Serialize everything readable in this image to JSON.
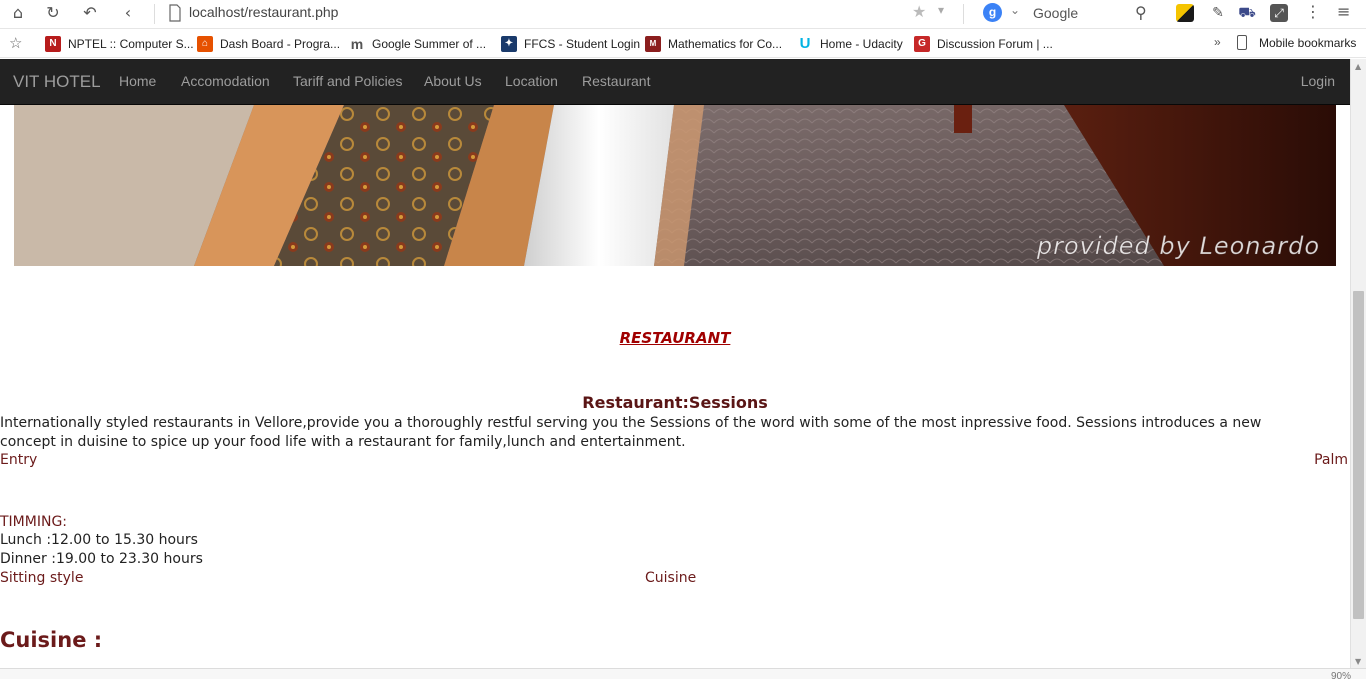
{
  "browser": {
    "url": "localhost/restaurant.php",
    "search_engine": "Google",
    "search_badge": "g",
    "zoom": "90%",
    "bookmarks": [
      {
        "label": "NPTEL :: Computer S...",
        "icon": "nptel-icon",
        "color": "#b71c1c",
        "glyph": "N"
      },
      {
        "label": "Dash Board - Progra...",
        "icon": "dashboard-icon",
        "color": "#e65100",
        "glyph": "⌂"
      },
      {
        "label": "Google Summer of ...",
        "icon": "gsoc-icon",
        "color": "#ffffff",
        "glyph": "m"
      },
      {
        "label": "FFCS - Student Login",
        "icon": "ffcs-icon",
        "color": "#1a3a6b",
        "glyph": "✦"
      },
      {
        "label": "Mathematics for Co...",
        "icon": "mit-icon",
        "color": "#8b1e1e",
        "glyph": "M"
      },
      {
        "label": "Home - Udacity",
        "icon": "udacity-icon",
        "color": "#ffffff",
        "glyph": "U"
      },
      {
        "label": "Discussion Forum | ...",
        "icon": "forum-icon",
        "color": "#c62828",
        "glyph": "G"
      }
    ],
    "more_label": "»",
    "mobile_bookmarks": "Mobile bookmarks"
  },
  "nav": {
    "brand": "VIT HOTEL",
    "links": [
      "Home",
      "Accomodation",
      "Tariff and Policies",
      "About Us",
      "Location",
      "Restaurant"
    ],
    "login": "Login"
  },
  "hero": {
    "caption": "provided by Leonardo"
  },
  "main": {
    "title": "RESTAURANT",
    "subtitle": "Restaurant:Sessions",
    "description": "Internationally styled restaurants in Vellore,provide you a thoroughly restful serving you the Sessions of the word with some of the most inpressive food. Sessions introduces a new concept in duisine to spice up your food life with a restaurant for family,lunch and entertainment.",
    "entry_label": "Entry",
    "palm_label": "Palm",
    "timing_heading": "TIMMING:",
    "lunch": "Lunch :12.00 to 15.30 hours",
    "dinner": "Dinner :19.00 to 23.30 hours",
    "sitting_label": "Sitting style",
    "cuisine_label": "Cuisine",
    "cuisine_heading": "Cuisine :"
  },
  "colors": {
    "navbar_bg": "#222222",
    "navbar_text": "#9d9d9d",
    "title_red": "#a00000",
    "label_maroon": "#6b1a1a"
  }
}
